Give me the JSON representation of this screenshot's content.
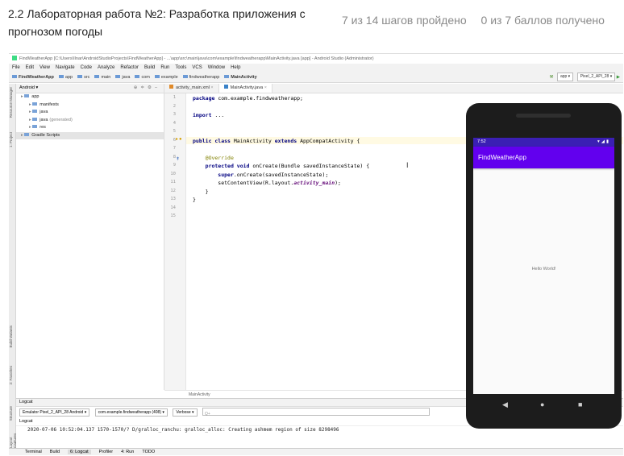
{
  "lesson": {
    "title": "2.2 Лабораторная работа №2: Разработка приложения с прогнозом погоды",
    "steps_passed": "7 из 14 шагов пройдено",
    "points": "0 из 7 баллов получено"
  },
  "ide": {
    "window_title": "FindWeatherApp [C:\\Users\\Ilnar\\AndroidStudioProjects\\FindWeatherApp] - ...\\app\\src\\main\\java\\com\\example\\findweatherapp\\MainActivity.java [app] - Android Studio (Administrator)",
    "menu": [
      "File",
      "Edit",
      "View",
      "Navigate",
      "Code",
      "Analyze",
      "Refactor",
      "Build",
      "Run",
      "Tools",
      "VCS",
      "Window",
      "Help"
    ],
    "breadcrumbs": [
      "FindWeatherApp",
      "app",
      "src",
      "main",
      "java",
      "com",
      "example",
      "findweatherapp",
      "MainActivity"
    ],
    "run_config": "app",
    "device_select": "Pixel_2_API_28",
    "left_strip_labels": [
      "Resource Manager",
      "1: Project",
      "Build Variants",
      "2: Favorites",
      "Structure",
      "Layout Captures"
    ],
    "project_panel": {
      "view_mode": "Android",
      "tree": [
        {
          "label": "app",
          "note": "",
          "indent": 0
        },
        {
          "label": "manifests",
          "note": "",
          "indent": 1
        },
        {
          "label": "java",
          "note": "",
          "indent": 1
        },
        {
          "label": "java",
          "note": "(generated)",
          "indent": 1
        },
        {
          "label": "res",
          "note": "",
          "indent": 1
        },
        {
          "label": "Gradle Scripts",
          "note": "",
          "indent": 0
        }
      ]
    },
    "tabs": [
      "activity_main.xml",
      "MainActivity.java"
    ],
    "code_lines": [
      {
        "n": "1",
        "parts": [
          {
            "t": "package ",
            "c": "kw"
          },
          {
            "t": "com.example.findweatherapp;",
            "c": ""
          }
        ]
      },
      {
        "n": "2",
        "parts": []
      },
      {
        "n": "3",
        "parts": [
          {
            "t": "import ",
            "c": "kw"
          },
          {
            "t": "...",
            "c": ""
          }
        ]
      },
      {
        "n": "4",
        "parts": []
      },
      {
        "n": "5",
        "parts": []
      },
      {
        "n": "6",
        "parts": [
          {
            "t": "public class ",
            "c": "kw"
          },
          {
            "t": "MainActivity ",
            "c": ""
          },
          {
            "t": "extends ",
            "c": "kw"
          },
          {
            "t": "AppCompatActivity {",
            "c": ""
          }
        ]
      },
      {
        "n": "7",
        "parts": []
      },
      {
        "n": "8",
        "parts": [
          {
            "t": "    @Override",
            "c": "ann"
          }
        ]
      },
      {
        "n": "9",
        "parts": [
          {
            "t": "    protected void ",
            "c": "kw"
          },
          {
            "t": "onCreate(Bundle savedInstanceState) {",
            "c": ""
          }
        ]
      },
      {
        "n": "10",
        "parts": [
          {
            "t": "        super",
            "c": "kw"
          },
          {
            "t": ".onCreate(savedInstanceState);",
            "c": ""
          }
        ]
      },
      {
        "n": "11",
        "parts": [
          {
            "t": "        setContentView(R.layout.",
            "c": ""
          },
          {
            "t": "activity_main",
            "c": "fld"
          },
          {
            "t": ");",
            "c": ""
          }
        ]
      },
      {
        "n": "12",
        "parts": [
          {
            "t": "    }",
            "c": ""
          }
        ]
      },
      {
        "n": "13",
        "parts": [
          {
            "t": "}",
            "c": ""
          }
        ]
      },
      {
        "n": "14",
        "parts": []
      },
      {
        "n": "15",
        "parts": []
      }
    ],
    "editor_footer": "MainActivity",
    "logcat": {
      "title": "Logcat",
      "device": "Emulator Pixel_2_API_28 Android",
      "process": "com.example.findweatherapp (408)",
      "level": "Verbose",
      "search_placeholder": "Q+",
      "sub_title": "Logcat",
      "lines": [
        "2020-07-06 10:52:04.137 1570-1570/? D/gralloc_ranchu: gralloc_alloc: Creating ashmem region of size 8298496"
      ]
    },
    "bottom_tabs": [
      "Terminal",
      "Build",
      "6: Logcat",
      "Profiler",
      "4: Run",
      "TODO"
    ]
  },
  "emulator": {
    "time": "7:52",
    "status_icons": "▾◢▮",
    "app_title": "FindWeatherApp",
    "hello_text": "Hello World!",
    "nav_back": "◀",
    "nav_home": "●",
    "nav_recent": "■"
  },
  "colors": {
    "primary": "#6200ee",
    "status_bar": "#3b1fb4",
    "keyword": "#000080",
    "annotation": "#808000"
  }
}
